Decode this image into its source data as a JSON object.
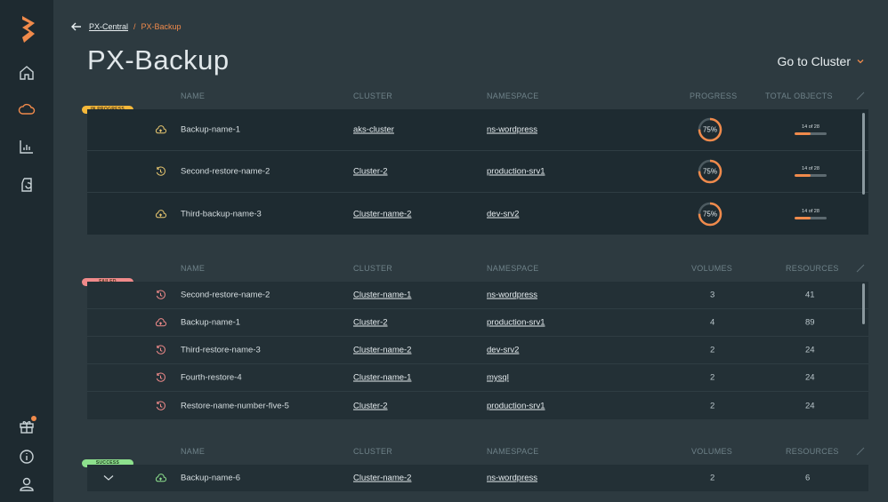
{
  "breadcrumb": {
    "parent": "PX-Central",
    "separator": "/",
    "current": "PX-Backup"
  },
  "page": {
    "title": "PX-Backup",
    "goto_cluster": "Go to Cluster"
  },
  "colors": {
    "accent": "#f08a4b",
    "in_progress": "#f5b83a",
    "failed": "#f08a8a",
    "success": "#8de08d"
  },
  "sections": {
    "in_progress": {
      "status": "IN PROGRESS",
      "headers": {
        "name": "NAME",
        "cluster": "CLUSTER",
        "namespace": "NAMESPACE",
        "progress": "PROGRESS",
        "total_objects": "TOTAL OBJECTS"
      },
      "rows": [
        {
          "icon": "upload-cloud-icon",
          "name": "Backup-name-1",
          "cluster": "aks-cluster",
          "namespace": "ns-wordpress",
          "progress": "75%",
          "progress_value": 0.75,
          "objects": "14 of 28",
          "objects_fraction": 0.5
        },
        {
          "icon": "restore-history-icon",
          "name": "Second-restore-name-2",
          "cluster": "Cluster-2",
          "namespace": "production-srv1",
          "progress": "75%",
          "progress_value": 0.75,
          "objects": "14 of 28",
          "objects_fraction": 0.5
        },
        {
          "icon": "upload-cloud-icon",
          "name": "Third-backup-name-3",
          "cluster": "Cluster-name-2",
          "namespace": "dev-srv2",
          "progress": "75%",
          "progress_value": 0.75,
          "objects": "14 of 28",
          "objects_fraction": 0.5
        }
      ]
    },
    "failed": {
      "status": "FAILED",
      "headers": {
        "name": "NAME",
        "cluster": "CLUSTER",
        "namespace": "NAMESPACE",
        "volumes": "VOLUMES",
        "resources": "RESOURCES"
      },
      "rows": [
        {
          "icon": "restore-history-icon",
          "name": "Second-restore-name-2",
          "cluster": "Cluster-name-1",
          "namespace": "ns-wordpress",
          "volumes": "3",
          "resources": "41"
        },
        {
          "icon": "upload-cloud-icon",
          "name": "Backup-name-1",
          "cluster": "Cluster-2",
          "namespace": "production-srv1",
          "volumes": "4",
          "resources": "89"
        },
        {
          "icon": "restore-history-icon",
          "name": "Third-restore-name-3",
          "cluster": "Cluster-name-2",
          "namespace": "dev-srv2",
          "volumes": "2",
          "resources": "24"
        },
        {
          "icon": "restore-history-icon",
          "name": "Fourth-restore-4",
          "cluster": "Cluster-name-1",
          "namespace": "mysql",
          "volumes": "2",
          "resources": "24"
        },
        {
          "icon": "restore-history-icon",
          "name": "Restore-name-number-five-5",
          "cluster": "Cluster-2",
          "namespace": "production-srv1",
          "volumes": "2",
          "resources": "24"
        }
      ]
    },
    "success": {
      "status": "SUCCESS",
      "headers": {
        "name": "NAME",
        "cluster": "CLUSTER",
        "namespace": "NAMESPACE",
        "volumes": "VOLUMES",
        "resources": "RESOURCES"
      },
      "rows": [
        {
          "icon": "upload-cloud-icon",
          "name": "Backup-name-6",
          "cluster": "Cluster-name-2",
          "namespace": "ns-wordpress",
          "volumes": "2",
          "resources": "6"
        }
      ]
    }
  }
}
